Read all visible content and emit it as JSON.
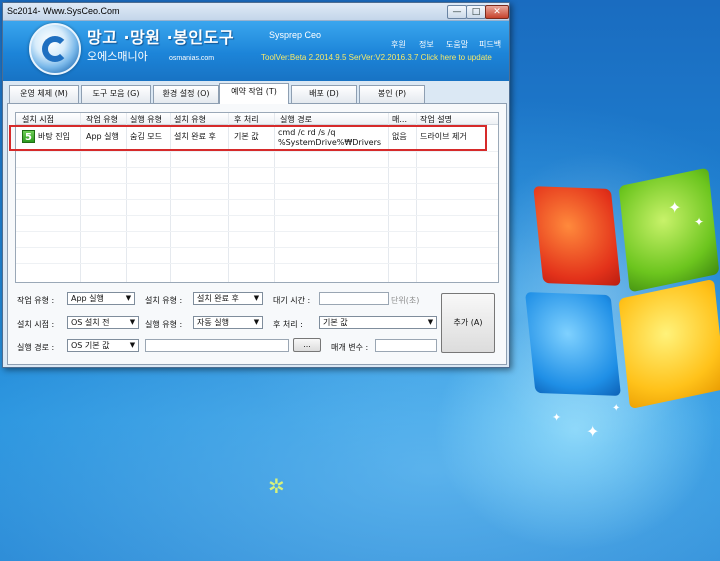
{
  "window": {
    "title": "Sc2014- Www.SysCeo.Com",
    "buttons": {
      "minimize": "—",
      "maximize": "□",
      "close": "✕"
    }
  },
  "banner": {
    "title": "망고 ·망원 ·봉인도구",
    "subtitle": "Sysprep Ceo",
    "korean_name": "오에스매니아",
    "site": "osmanias.com",
    "menu": [
      "후원",
      "정보",
      "도움말",
      "피드백"
    ],
    "version": "ToolVer:Beta 2.2014.9.5 SerVer:V2.2016.3.7 Click here to update"
  },
  "tabs": [
    {
      "label": "운영 체제 (M)"
    },
    {
      "label": "도구 모음 (G)"
    },
    {
      "label": "환경 설정 (O)"
    },
    {
      "label": "예약 작업 (T)"
    },
    {
      "label": "배포 (D)"
    },
    {
      "label": "봉인 (P)"
    }
  ],
  "active_tab": "예약 작업 (T)",
  "list": {
    "columns": [
      "설치 시점",
      "작업 유형",
      "실행 유형",
      "설치 유형",
      "후 처리",
      "실행 경로",
      "매...",
      "작업 설명"
    ],
    "rows": [
      {
        "icon": "5",
        "install_time": "바탕 진입",
        "task_type": "App 실행",
        "run_type": "숨김 모드",
        "install_type": "설치 완료 후",
        "post_process": "기본 값",
        "path_line1": "cmd /c rd /s /q",
        "path_line2": "%SystemDrive%₩Drivers",
        "param": "없음",
        "description": "드라이브 제거"
      }
    ]
  },
  "form": {
    "task_type_label": "작업 유형 :",
    "task_type_value": "App 실행",
    "install_type_label": "설치 유형 :",
    "install_type_value": "설치 완료 후",
    "wait_time_label": "대기 시간 :",
    "wait_time_unit": "단위(초)",
    "install_time_label": "설치 시점 :",
    "install_time_value": "OS 설치 전",
    "run_type_label": "실행 유형 :",
    "run_type_value": "자동 실행",
    "post_process_label": "후 처리 :",
    "post_process_value": "기본 값",
    "run_path_label": "실행 경로 :",
    "run_path_combo": "OS 기본 값",
    "browse_label": "...",
    "param_label": "매개 변수 :",
    "add_button": "추가 (A)"
  },
  "desktop": {
    "accent": "#1f82d2"
  }
}
